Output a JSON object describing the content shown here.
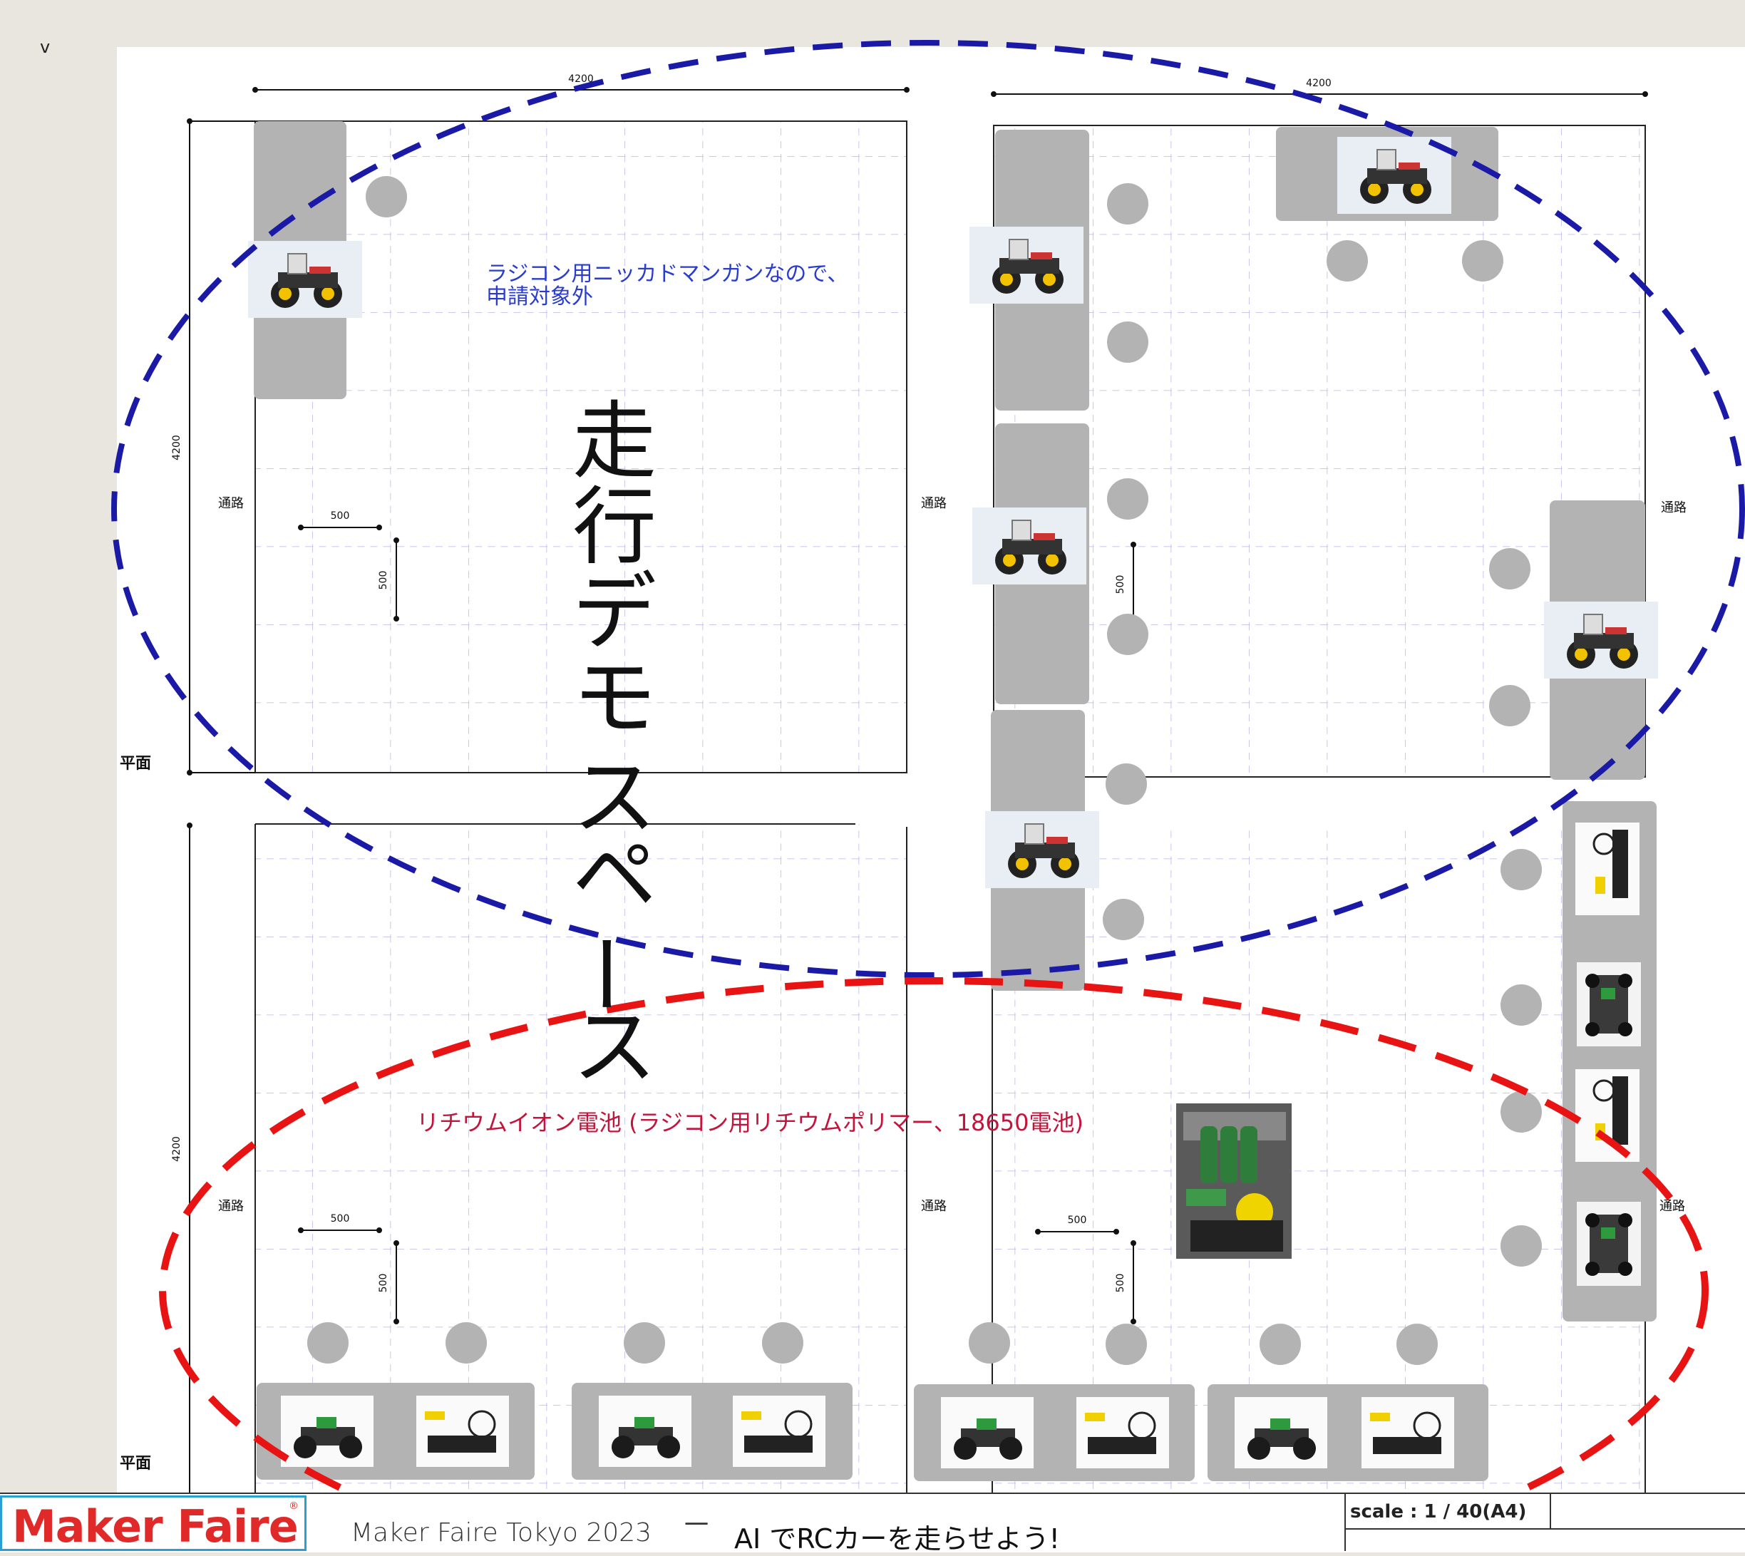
{
  "corner_mark": "v",
  "dimensions": {
    "width_4200": "4200",
    "height_4200": "4200",
    "unit_500": "500"
  },
  "labels": {
    "aisle": "通路",
    "plan": "平面",
    "note_nimh_line1": "ラジコン用ニッカドマンガンなので、",
    "note_nimh_line2": "申請対象外",
    "demo_space_vertical": [
      "走",
      "行",
      "デ",
      "モ",
      "ス",
      "ペ",
      "ー",
      "ス"
    ],
    "lithium_note": "リチウムイオン電池 (ラジコン用リチウムポリマー、18650電池)"
  },
  "footer": {
    "logo": "Maker Faire",
    "logo_reg": "®",
    "event": "Maker Faire Tokyo 2023",
    "dash": "一",
    "title": "AI でRCカーを走らせよう!",
    "scale": "scale : 1 / 40(A4)"
  },
  "colors": {
    "blue_ellipse": "#1a1aa6",
    "red_ellipse": "#e81414",
    "note_blue": "#2a3ccf",
    "note_red": "#c4143c",
    "table_gray": "#b3b3b3",
    "grid": "#b6b6ee"
  }
}
